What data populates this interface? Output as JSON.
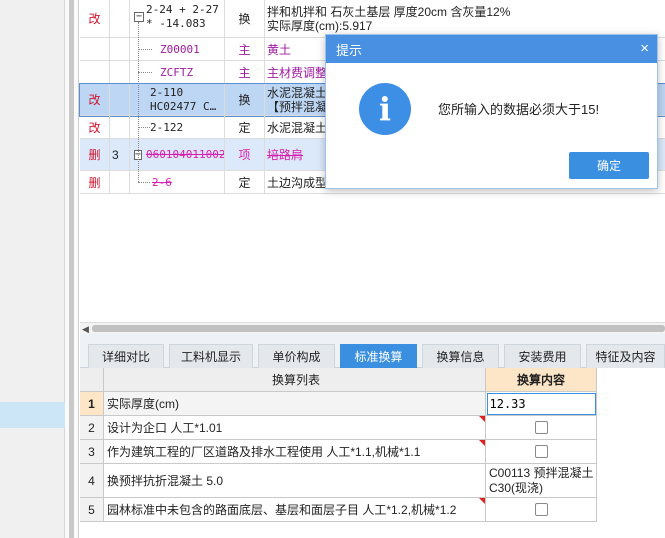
{
  "upper_rows": [
    {
      "flag": "改",
      "num": "",
      "code": "2-24 + 2-27 * -14.083",
      "type": "换",
      "name_line1": "拌和机拌和 石灰土基层 厚度20cm 含灰量12%",
      "name_line2": "实际厚度(cm):5.917"
    },
    {
      "flag": "",
      "num": "",
      "code": "Z00001",
      "type": "主",
      "name": "黄土"
    },
    {
      "flag": "",
      "num": "",
      "code": "ZCFTZ",
      "type": "主",
      "name": "主材费调整"
    },
    {
      "flag": "改",
      "num": "",
      "code_line1": "2-110",
      "code_line2": "HC02477 C…",
      "type": "换",
      "name_line1": "水泥混凝土",
      "name_line2": "【预拌混凝土"
    },
    {
      "flag": "改",
      "num": "",
      "code": "2-122",
      "type": "定",
      "name": "水泥混凝土"
    },
    {
      "flag": "删",
      "num": "3",
      "code": "060104011002",
      "type": "项",
      "name": "培路肩"
    },
    {
      "flag": "删",
      "num": "",
      "code": "2-6",
      "type": "定",
      "name": "土边沟成型"
    }
  ],
  "tabs": [
    "详细对比",
    "工料机显示",
    "单价构成",
    "标准换算",
    "换算信息",
    "安装费用",
    "特征及内容"
  ],
  "active_tab": "标准换算",
  "lower_headers": {
    "list": "换算列表",
    "content": "换算内容"
  },
  "lower_rows": [
    {
      "num": "1",
      "desc": "实际厚度(cm)",
      "value": "12.33"
    },
    {
      "num": "2",
      "desc": "设计为企口 人工*1.01",
      "value": ""
    },
    {
      "num": "3",
      "desc": "作为建筑工程的厂区道路及排水工程使用 人工*1.1,机械*1.1",
      "value": ""
    },
    {
      "num": "4",
      "desc": "换预拌抗折混凝土 5.0",
      "value": "C00113  预拌混凝土 C30(现浇)"
    },
    {
      "num": "5",
      "desc": "园林标准中未包含的路面底层、基层和面层子目 人工*1.2,机械*1.2",
      "value": ""
    }
  ],
  "dialog": {
    "title": "提示",
    "message": "您所输入的数据必须大于15!",
    "ok_label": "确定",
    "close_symbol": "×",
    "info_symbol": "i"
  },
  "icons": {
    "expander_minus": "−",
    "scroll_left": "◀"
  },
  "colors": {
    "accent": "#3b8fe0",
    "flag_red": "#d2142c",
    "code_purple": "#a01aa0",
    "deleted_magenta": "#d91fb2",
    "header_orange": "#fde6c8"
  }
}
